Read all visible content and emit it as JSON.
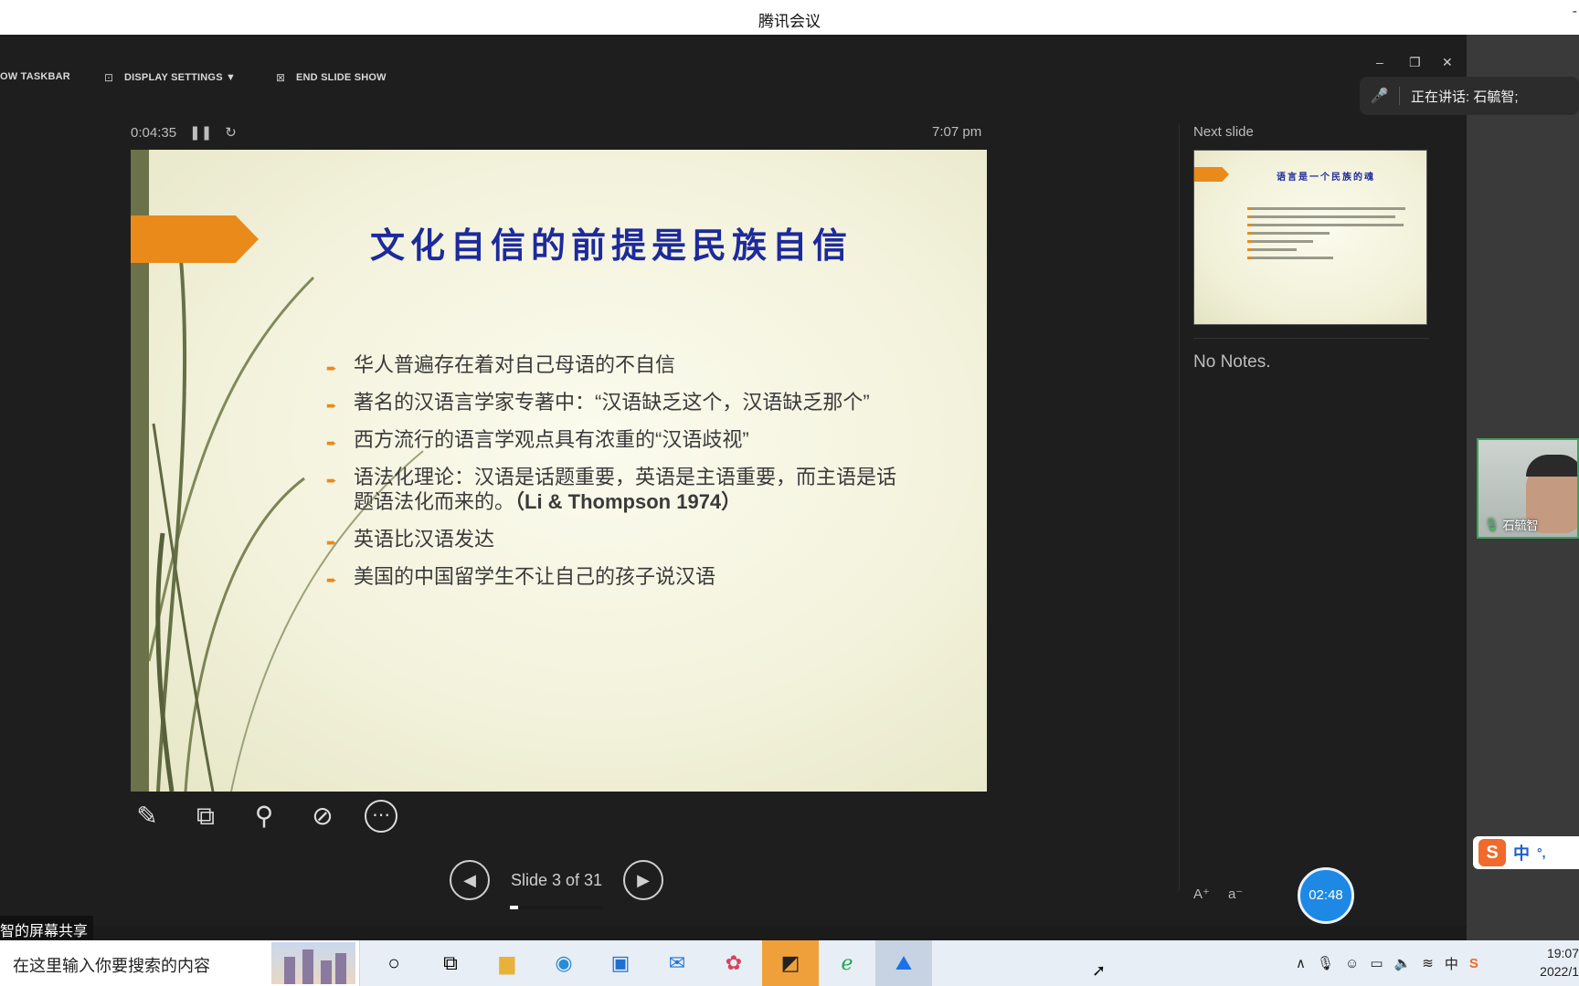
{
  "window": {
    "title": "腾讯会议",
    "minimize": "-"
  },
  "ppt_toolbar": {
    "show_taskbar": "OW TASKBAR",
    "display_settings": "DISPLAY SETTINGS ▼",
    "end_slide_show": "END SLIDE SHOW"
  },
  "speaking": {
    "label": "正在讲话: 石毓智;"
  },
  "presenter": {
    "elapsed": "0:04:35",
    "clock": "7:07 pm",
    "slide": {
      "title": "文化自信的前提是民族自信",
      "bullets": [
        "华人普遍存在着对自己母语的不自信",
        "著名的汉语言学家专著中：“汉语缺乏这个，汉语缺乏那个”",
        "西方流行的语言学观点具有浓重的“汉语歧视”",
        "语法化理论：汉语是话题重要，英语是主语重要，而主语是话题语法化而来的。",
        "英语比汉语发达",
        "美国的中国留学生不让自己的孩子说汉语"
      ],
      "citation": "（Li & Thompson 1974）"
    },
    "nav": {
      "label": "Slide 3 of 31",
      "progress": 0.09
    },
    "next_slide_label": "Next slide",
    "next_slide_title": "语言是一个民族的魂",
    "notes": "No Notes."
  },
  "meeting": {
    "timer": "02:48",
    "participant": "石毓智",
    "share_label": "智的屏幕共享",
    "ime": {
      "mode": "中",
      "punct": "°,"
    }
  },
  "taskbar": {
    "search_placeholder": "在这里输入你要搜索的内容",
    "time": "19:07",
    "date": "2022/1"
  }
}
